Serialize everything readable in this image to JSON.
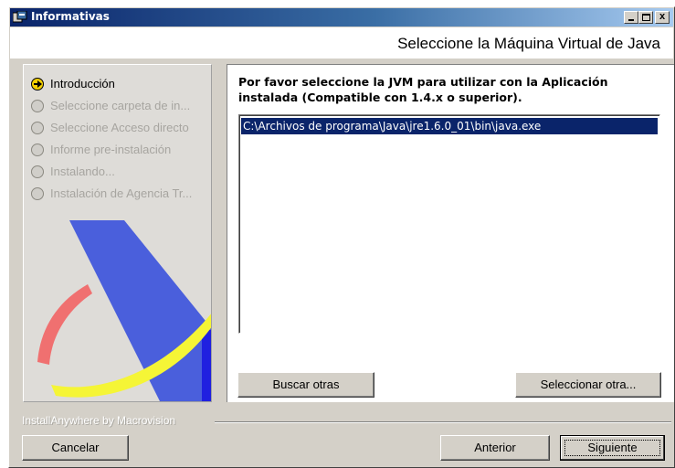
{
  "window": {
    "title": "Informativas",
    "controls": {
      "minimize": "_",
      "maximize": "□",
      "close": "x"
    }
  },
  "header": {
    "title": "Seleccione la Máquina Virtual de Java"
  },
  "steps": [
    {
      "label": "Introducción",
      "active": true
    },
    {
      "label": "Seleccione carpeta de in...",
      "active": false
    },
    {
      "label": "Seleccione  Acceso directo",
      "active": false
    },
    {
      "label": "Informe pre-instalación",
      "active": false
    },
    {
      "label": "Instalando...",
      "active": false
    },
    {
      "label": "Instalación de Agencia Tr...",
      "active": false
    }
  ],
  "main": {
    "instruction": "Por favor seleccione  la  JVM para utilizar con la Aplicación instalada (Compatible con 1.4.x o superior).",
    "jvm_list": [
      {
        "path": "C:\\Archivos de programa\\Java\\jre1.6.0_01\\bin\\java.exe",
        "selected": true
      }
    ],
    "search_button": "Buscar otras",
    "select_button": "Seleccionar otra..."
  },
  "footer": {
    "brand": "InstallAnywhere by Macrovision",
    "cancel_button": "Cancelar",
    "previous_button": "Anterior",
    "next_button": "Siguiente"
  },
  "colors": {
    "title_bar": "#0a246a",
    "selection": "#0a246a",
    "logo_blue": "#4a5fdc",
    "logo_yellow": "#f5f536",
    "logo_red": "#f07070"
  }
}
